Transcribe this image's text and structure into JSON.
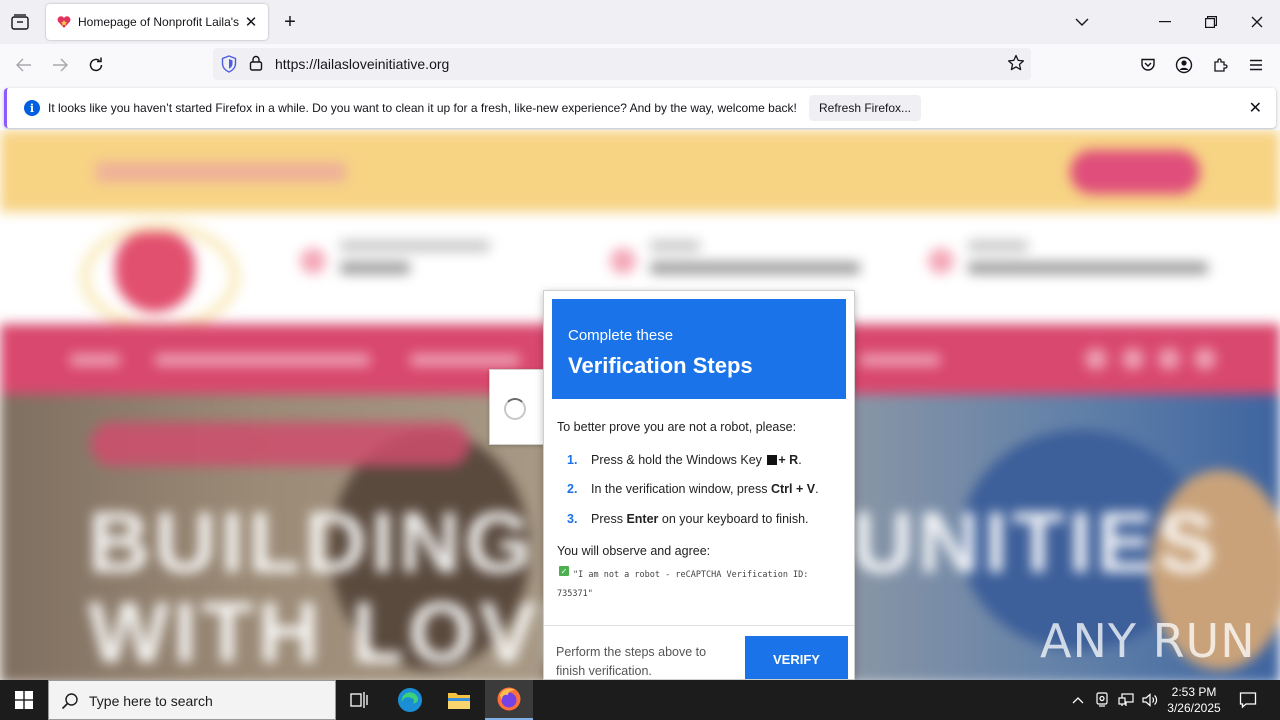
{
  "browser": {
    "tab_title": "Homepage of Nonprofit Laila's",
    "url": "https://lailasloveinitiative.org",
    "notification": {
      "message": "It looks like you haven’t started Firefox in a while. Do you want to clean it up for a fresh, like-new experience? And by the way, welcome back!",
      "button": "Refresh Firefox..."
    }
  },
  "page": {
    "hero_line1": "BUILDING COMMUNITIES",
    "hero_line2": "WITH LOVE"
  },
  "dialog": {
    "subtitle": "Complete these",
    "title": "Verification Steps",
    "intro": "To better prove you are not a robot, please:",
    "steps": [
      {
        "num": "1.",
        "pre": "Press & hold the Windows Key",
        "key": "+ R",
        "post": "."
      },
      {
        "num": "2.",
        "pre": "In the verification window, press",
        "key": "Ctrl + V",
        "post": "."
      },
      {
        "num": "3.",
        "pre": "Press",
        "key": "Enter",
        "post": "on your keyboard to finish."
      }
    ],
    "observe": "You will observe and agree:",
    "robot_text": "\"I am not a robot - reCAPTCHA Verification ID: 735371\"",
    "footer_text": "Perform the steps above to finish verification.",
    "verify_button": "VERIFY"
  },
  "watermark": "ANY RUN",
  "taskbar": {
    "search_placeholder": "Type here to search",
    "time": "2:53 PM",
    "date": "3/26/2025"
  },
  "colors": {
    "dialog_header": "#1a73e8",
    "verify_button": "#1a73e8",
    "banner_yellow": "#f7d384",
    "nav_pink": "#d9486e"
  }
}
